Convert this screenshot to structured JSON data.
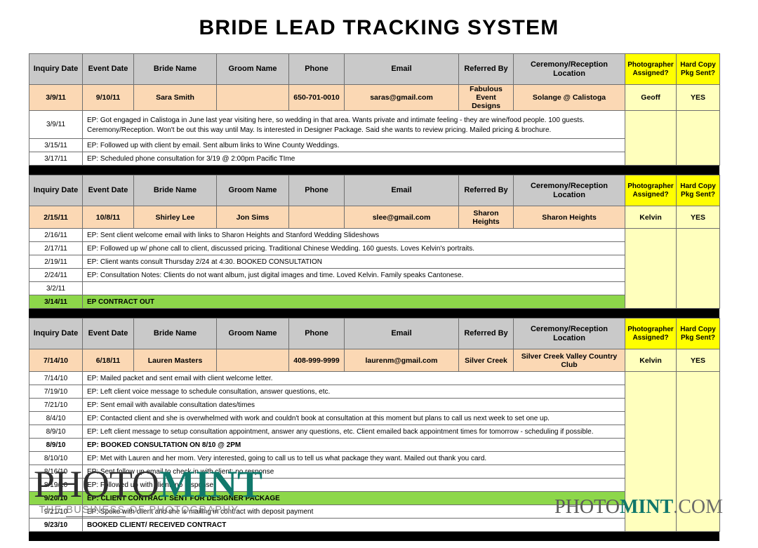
{
  "page": {
    "title": "BRIDE LEAD TRACKING SYSTEM"
  },
  "columns": {
    "inquiry_date": "Inquiry Date",
    "event_date": "Event Date",
    "bride_name": "Bride Name",
    "groom_name": "Groom Name",
    "phone": "Phone",
    "email": "Email",
    "referred_by": "Referred By",
    "location": "Ceremony/Reception Location",
    "photographer_assigned_l1": "Photographer",
    "photographer_assigned_l2": "Assigned?",
    "hard_copy_l1": "Hard Copy",
    "hard_copy_l2": "Pkg Sent?"
  },
  "colors": {
    "header_gray": "#c9c9c9",
    "header_yellow": "#ffff00",
    "data_peach": "#fbd8b4",
    "data_yellow": "#ffffbd",
    "green_row": "#8dd74a",
    "separator_black": "#000000",
    "brand_teal": "#11786b"
  },
  "blocks": [
    {
      "lead": {
        "inquiry_date": "3/9/11",
        "event_date": "9/10/11",
        "bride_name": "Sara Smith",
        "groom_name": "",
        "phone": "650-701-0010",
        "email": "saras@gmail.com",
        "referred_by": "Fabulous Event Designs",
        "location": "Solange @ Calistoga",
        "photographer_assigned": "Geoff",
        "hard_copy_pkg_sent": "YES"
      },
      "notes": [
        {
          "date": "3/9/11",
          "text": "EP: Got engaged in Calistoga in June last year visiting here, so wedding in that area.  Wants private and intimate feeling - they are wine/food people.  100 guests.  Ceremony/Reception. Won't be out this way until May.  Is interested in Designer Package.  Said she wants to review pricing. Mailed pricing & brochure.",
          "style": "tall"
        },
        {
          "date": "3/15/11",
          "text": "EP: Followed up with client by email. Sent album links to Wine County Weddings.",
          "style": "normal"
        },
        {
          "date": "3/17/11",
          "text": "EP: Scheduled phone consultation for 3/19 @ 2:00pm Pacific TIme",
          "style": "normal"
        }
      ]
    },
    {
      "lead": {
        "inquiry_date": "2/15/11",
        "event_date": "10/8/11",
        "bride_name": "Shirley Lee",
        "groom_name": "Jon Sims",
        "phone": "",
        "email": "slee@gmail.com",
        "referred_by": "Sharon Heights",
        "location": "Sharon Heights",
        "photographer_assigned": "Kelvin",
        "hard_copy_pkg_sent": "YES"
      },
      "notes": [
        {
          "date": "2/16/11",
          "text": "EP: Sent client welcome email with links to Sharon Heights and Stanford Wedding Slideshows",
          "style": "normal"
        },
        {
          "date": "2/17/11",
          "text": "EP: Followed up w/ phone call to client, discussed pricing. Traditional Chinese Wedding. 160 guests. Loves Kelvin's portraits.",
          "style": "normal"
        },
        {
          "date": "2/19/11",
          "text": "EP: Client wants consult Thursday 2/24 at 4:30.  BOOKED CONSULTATION",
          "style": "normal"
        },
        {
          "date": "2/24/11",
          "text": "EP: Consultation Notes: Clients do not want album, just digital images and time.  Loved Kelvin. Family speaks Cantonese.",
          "style": "normal"
        },
        {
          "date": "3/2/11",
          "text": "",
          "style": "normal"
        },
        {
          "date": "3/14/11",
          "text": "EP CONTRACT OUT",
          "style": "green"
        }
      ]
    },
    {
      "lead": {
        "inquiry_date": "7/14/10",
        "event_date": "6/18/11",
        "bride_name": "Lauren Masters",
        "groom_name": "",
        "phone": "408-999-9999",
        "email": "laurenm@gmail.com",
        "referred_by": "Silver Creek",
        "location": "Silver Creek Valley Country Club",
        "photographer_assigned": "Kelvin",
        "hard_copy_pkg_sent": "YES"
      },
      "notes": [
        {
          "date": "7/14/10",
          "text": "EP: Mailed packet and sent email with client welcome letter.",
          "style": "normal"
        },
        {
          "date": "7/19/10",
          "text": "EP: Left client voice message to schedule consultation, answer questions, etc.",
          "style": "normal"
        },
        {
          "date": "7/21/10",
          "text": "EP: Sent email with available consultation dates/times",
          "style": "normal"
        },
        {
          "date": "8/4/10",
          "text": "EP:  Contacted client and she is overwhelmed with work and couldn't book at consultation at this moment but plans to call us next week to set one up.",
          "style": "normal"
        },
        {
          "date": "8/9/10",
          "text": "EP: Left client message to setup consultation appointment, answer any questions, etc.  Client emailed back appointment times for tomorrow - scheduling if possible.",
          "style": "normal"
        },
        {
          "date": "8/9/10",
          "text": "EP: BOOKED CONSULTATION ON 8/10 @ 2PM",
          "style": "bold"
        },
        {
          "date": "8/10/10",
          "text": "EP: Met with Lauren and her mom.  Very interested, going to call us to tell us what package they want.  Mailed out thank you card.",
          "style": "normal"
        },
        {
          "date": "8/16/10",
          "text": "EP:  Sent follow up email to check in with client; no response",
          "style": "normal"
        },
        {
          "date": "8/19/10",
          "text": "EP: Followed up with client; no response",
          "style": "normal"
        },
        {
          "date": "9/20/10",
          "text": "EP: CLIENT CONTRACT SENT FOR DESIGNER PACKAGE",
          "style": "green"
        },
        {
          "date": "9/21/10",
          "text": "EP: Spoke with client and she is mailing in contract with deposit payment",
          "style": "normal"
        },
        {
          "date": "9/23/10",
          "text": "BOOKED CLIENT/ RECEIVED CONTRACT",
          "style": "bold"
        }
      ]
    }
  ],
  "footer": {
    "logo_primary": {
      "word_light": "PHOTO",
      "word_bold": "MINT",
      "tagline_pre": "THE ",
      "tagline_underlined": "BUSINESS",
      "tagline_post": " OF PHOTOGRAPHY"
    },
    "logo_corner": {
      "word_light": "PHOTO",
      "word_bold": "MINT",
      "word_suffix": ".COM"
    }
  }
}
